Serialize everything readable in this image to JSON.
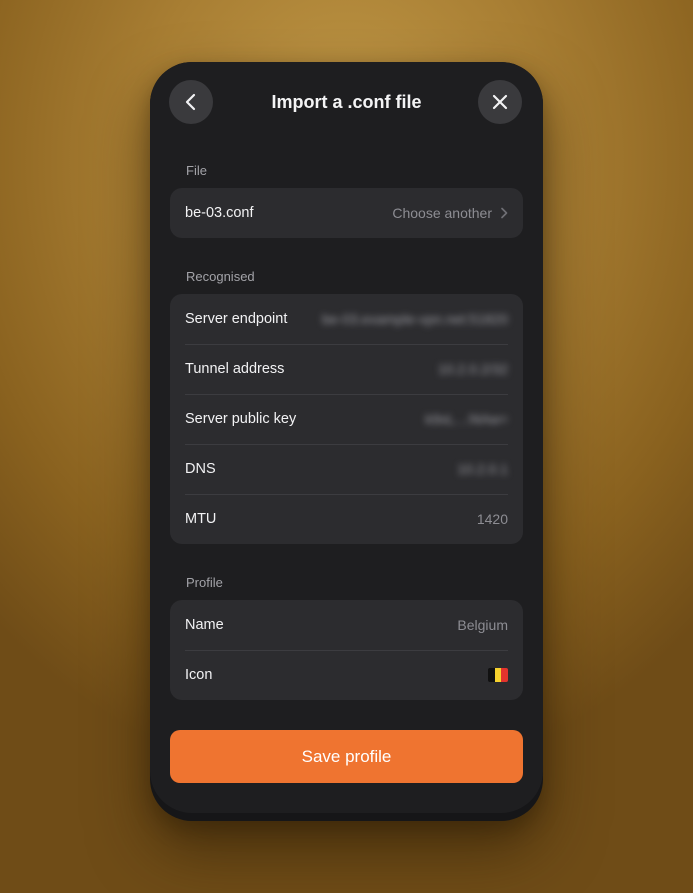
{
  "header": {
    "title": "Import a .conf file",
    "back_icon": "chevron-left-icon",
    "close_icon": "close-icon"
  },
  "file_section": {
    "label": "File",
    "filename": "be-03.conf",
    "action": "Choose another",
    "action_icon": "chevron-right-icon"
  },
  "recognised_section": {
    "label": "Recognised",
    "rows": [
      {
        "label": "Server endpoint",
        "value": "be-03.example-vpn.net:51820",
        "blurred": true
      },
      {
        "label": "Tunnel address",
        "value": "10.2.0.2/32",
        "blurred": true
      },
      {
        "label": "Server public key",
        "value": "k9xL…f4Aw=",
        "blurred": true
      },
      {
        "label": "DNS",
        "value": "10.2.0.1",
        "blurred": true
      },
      {
        "label": "MTU",
        "value": "1420",
        "blurred": false
      }
    ]
  },
  "profile_section": {
    "label": "Profile",
    "name_label": "Name",
    "name_value": "Belgium",
    "icon_label": "Icon",
    "icon_value": "belgium-flag-icon"
  },
  "save_button": {
    "label": "Save profile"
  },
  "colors": {
    "accent": "#ef7430",
    "panel": "#1e1e20",
    "card": "#2c2c2f",
    "flag_black": "#111111",
    "flag_yellow": "#f6d12e",
    "flag_red": "#e3332d"
  }
}
